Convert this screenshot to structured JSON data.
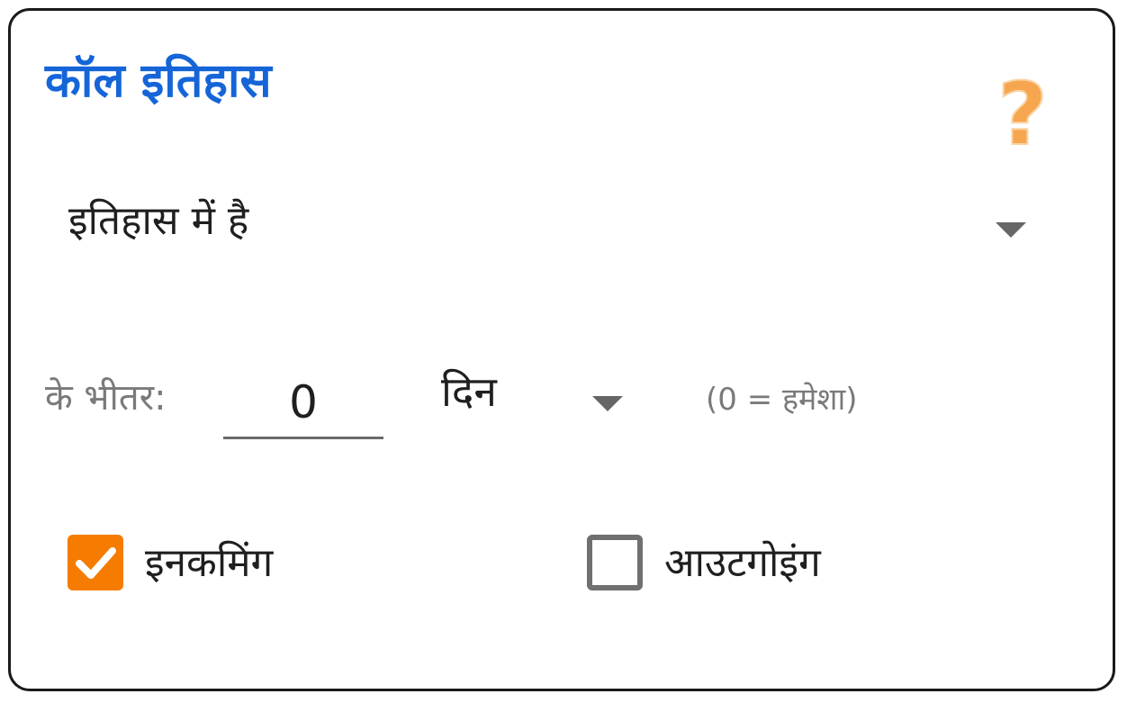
{
  "header": {
    "title": "कॉल इतिहास",
    "help_icon": "help-question-icon",
    "help_glyph": "?",
    "help_color": "#f6a64f"
  },
  "match_select": {
    "value": "इतिहास में है"
  },
  "within": {
    "label": "के भीतर:",
    "days_value": "0",
    "unit_value": "दिन",
    "hint": "(0 = हमेशा)"
  },
  "direction": {
    "incoming": {
      "label": "इनकमिंग",
      "checked": true
    },
    "outgoing": {
      "label": "आउटगोइंग",
      "checked": false
    }
  },
  "colors": {
    "title": "#1565d8",
    "accent_checkbox": "#f57c00"
  }
}
